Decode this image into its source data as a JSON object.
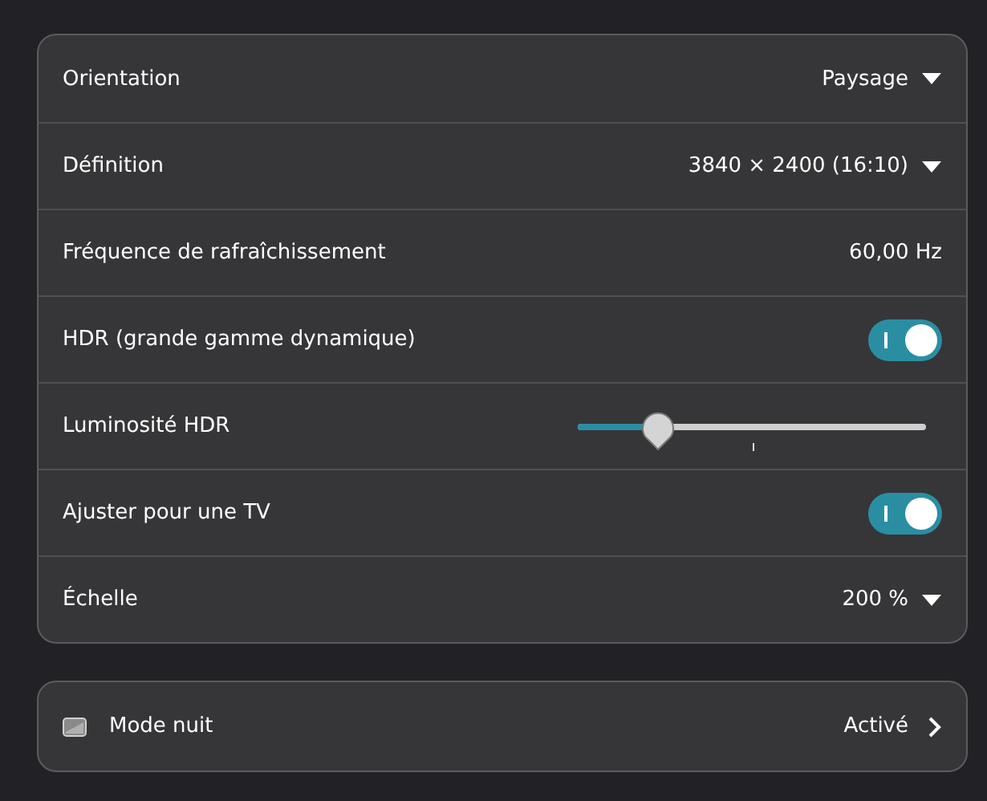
{
  "display_settings": [
    {
      "kind": "dropdown",
      "label": "Orientation",
      "value": "Paysage"
    },
    {
      "kind": "dropdown",
      "label": "Définition",
      "value": "3840 × 2400 (16:10)"
    },
    {
      "kind": "text",
      "label": "Fréquence de rafraîchissement",
      "value": "60,00 Hz"
    },
    {
      "kind": "toggle",
      "label": "HDR (grande gamme dynamique)",
      "on": true
    },
    {
      "kind": "slider",
      "label": "Luminosité HDR",
      "level": 0.23
    },
    {
      "kind": "toggle",
      "label": "Ajuster pour une TV",
      "on": true
    },
    {
      "kind": "dropdown",
      "label": "Échelle",
      "value": "200 %"
    }
  ],
  "night_mode": {
    "label": "Mode nuit",
    "value": "Activé"
  }
}
